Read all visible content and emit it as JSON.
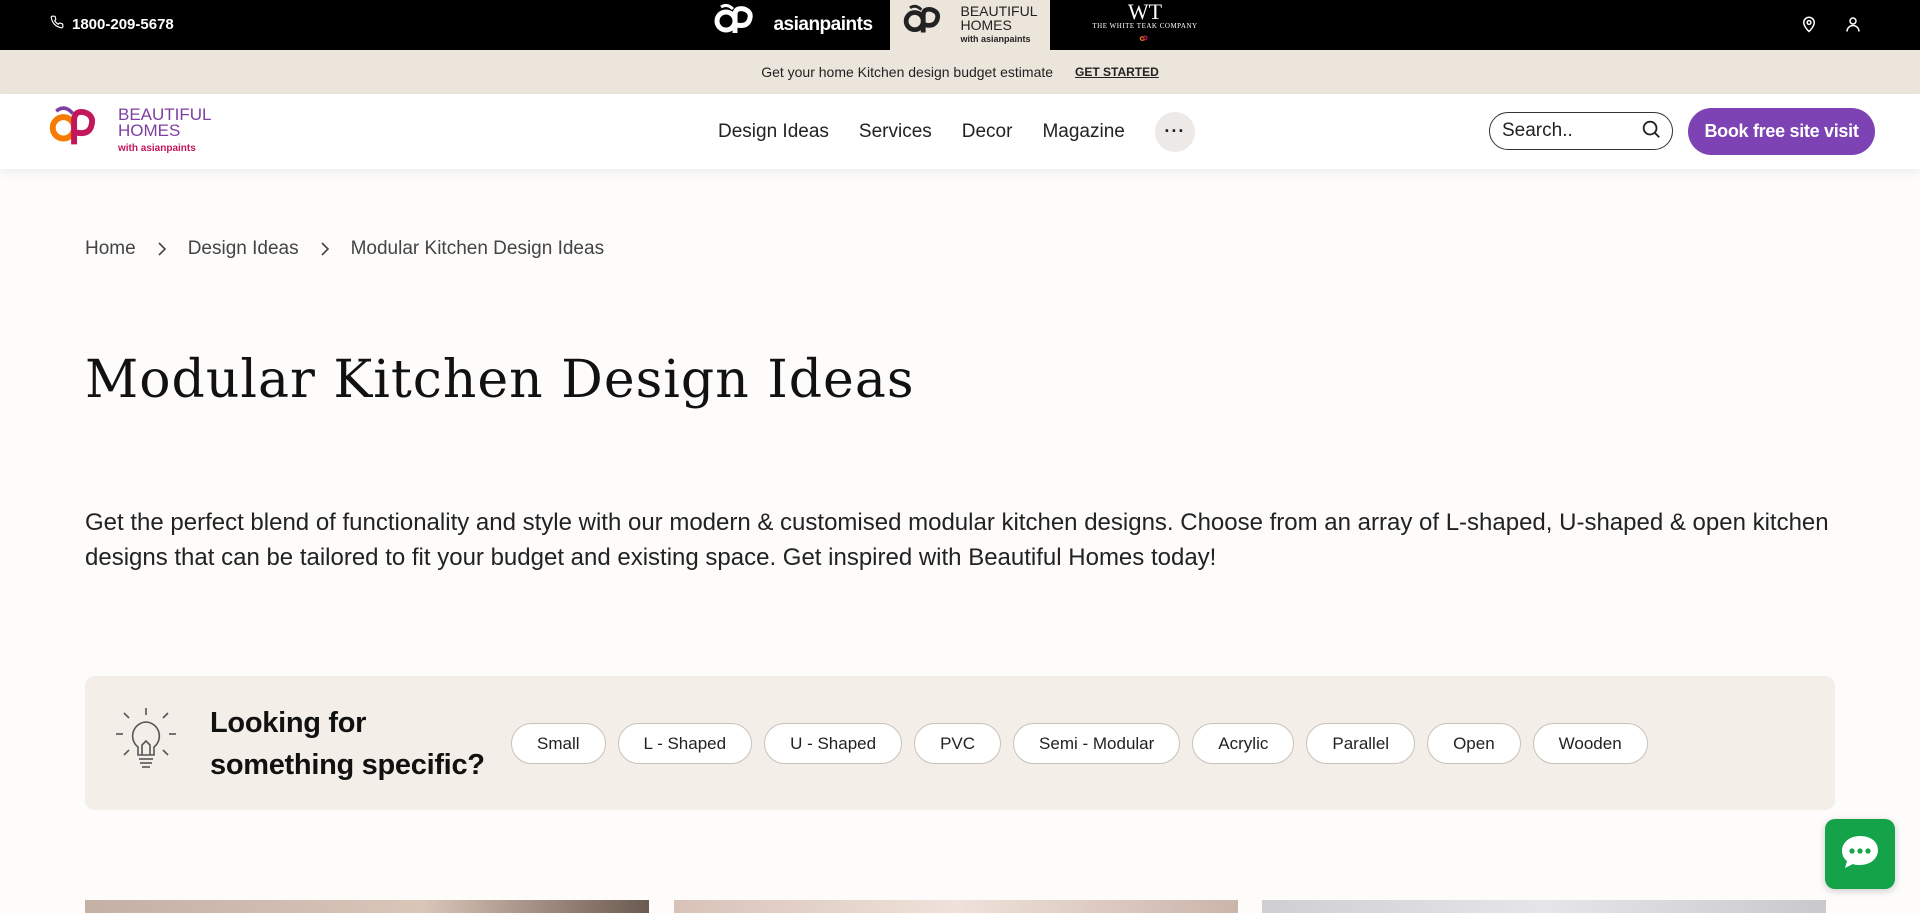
{
  "topbar": {
    "phone": "1800-209-5678",
    "brands": {
      "asianpaints": "asianpaints",
      "beautiful_homes_line1": "BEAUTIFUL",
      "beautiful_homes_line2": "HOMES",
      "beautiful_homes_sub": "with asianpaints",
      "white_teak_mark": "WT",
      "white_teak_name": "THE WHITE TEAK COMPANY"
    }
  },
  "promo": {
    "text": "Get your home Kitchen design budget estimate",
    "cta": "GET STARTED"
  },
  "nav": {
    "logo_line1": "BEAUTIFUL",
    "logo_line2": "HOMES",
    "logo_sub": "with asianpaints",
    "menu": [
      "Design Ideas",
      "Services",
      "Decor",
      "Magazine"
    ],
    "more": "···",
    "search_placeholder": "Search..",
    "book_cta": "Book free site visit"
  },
  "breadcrumb": [
    "Home",
    "Design Ideas",
    "Modular Kitchen Design Ideas"
  ],
  "page": {
    "title": "Modular Kitchen Design Ideas",
    "description": "Get the perfect blend of functionality and style with our modern & customised modular kitchen designs. Choose from an array of L-shaped, U-shaped & open kitchen designs that can be tailored to fit your budget and existing space. Get inspired with Beautiful Homes today!"
  },
  "filter": {
    "label_line1": "Looking for",
    "label_line2": "something specific?",
    "chips": [
      "Small",
      "L - Shaped",
      "U - Shaped",
      "PVC",
      "Semi - Modular",
      "Acrylic",
      "Parallel",
      "Open",
      "Wooden"
    ]
  },
  "colors": {
    "accent": "#7d43b4",
    "chat": "#15a34a",
    "promo_bg": "#ece5db"
  }
}
